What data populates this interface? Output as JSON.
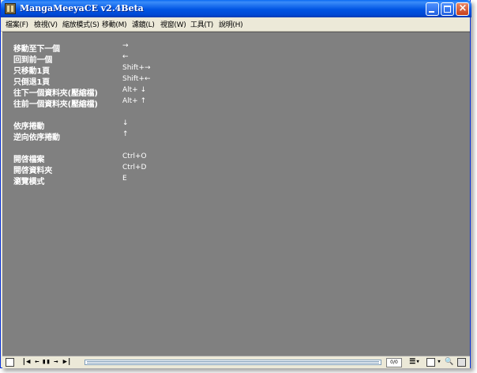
{
  "window": {
    "title": "MangaMeeyaCE v2.4Beta"
  },
  "menu": [
    {
      "label": "檔案(F)"
    },
    {
      "label": "檢視(V)"
    },
    {
      "label": "縮放模式(S)"
    },
    {
      "label": "移動(M)"
    },
    {
      "label": "濾鏡(L)"
    },
    {
      "label": "視窗(W)"
    },
    {
      "label": "工具(T)"
    },
    {
      "label": "說明(H)"
    }
  ],
  "shortcuts": [
    {
      "label": "移動至下一個",
      "key": "→"
    },
    {
      "label": "回到前一個",
      "key": "←"
    },
    {
      "label": "只移動1頁",
      "key": "Shift+→"
    },
    {
      "label": "只倒退1頁",
      "key": "Shift+←"
    },
    {
      "label": "往下一個資料夾(壓縮檔)",
      "key": "Alt+ ↓"
    },
    {
      "label": "往前一個資料夾(壓縮檔)",
      "key": "Alt+ ↑"
    },
    {
      "label": "依序捲動",
      "key": "↓"
    },
    {
      "label": "逆向依序捲動",
      "key": "↑"
    },
    {
      "label": "開啓檔案",
      "key": "Ctrl+O"
    },
    {
      "label": "開啓資料夾",
      "key": "Ctrl+D"
    },
    {
      "label": "瀏覽模式",
      "key": "E"
    }
  ],
  "statusbar": {
    "page_counter": "0/0"
  },
  "colors": {
    "titlebar": "#0054e3",
    "content_bg": "#808080",
    "text": "#ffffff"
  }
}
